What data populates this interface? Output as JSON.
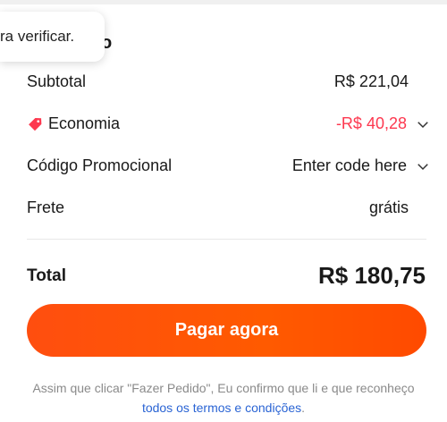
{
  "tooltip": {
    "text": "ra verificar."
  },
  "summary": {
    "title_fragment": "o",
    "subtotal_label": "Subtotal",
    "subtotal_value": "R$ 221,04",
    "savings_label": "Economia",
    "savings_value": "-R$ 40,28",
    "promo_label": "Código Promocional",
    "promo_value": "Enter code here",
    "shipping_label": "Frete",
    "shipping_value": "grátis",
    "total_label": "Total",
    "total_value": "R$ 180,75"
  },
  "actions": {
    "pay_label": "Pagar agora"
  },
  "legal": {
    "text": "Assim que clicar \"Fazer Pedido\", Eu confirmo que li e que reconheço",
    "link_text": "todos os termos e condições",
    "suffix": "."
  },
  "colors": {
    "accent": "#ff5a00",
    "discount": "#fd384f",
    "link": "#2a64d4"
  },
  "icons": {
    "savings": "price-tag-icon",
    "expand": "chevron-down-icon"
  }
}
